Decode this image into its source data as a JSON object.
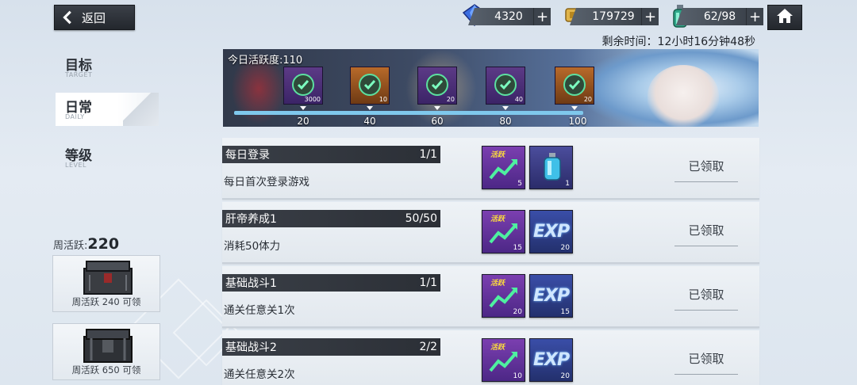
{
  "header": {
    "back_label": "返回",
    "crystals": "4320",
    "coins": "179729",
    "stamina": "62/98",
    "timer": "剩余时间：12小时16分钟48秒"
  },
  "sidebar": {
    "items": [
      {
        "zh": "目标",
        "en": "TARGET"
      },
      {
        "zh": "日常",
        "en": "DAILY"
      },
      {
        "zh": "等级",
        "en": "LEVEL"
      }
    ],
    "weekly_prefix": "周活跃:",
    "weekly_value": "220",
    "chests": [
      {
        "caption": "周活跃 240 可领"
      },
      {
        "caption": "周活跃 650 可领"
      }
    ]
  },
  "banner": {
    "title": "今日活跃度:110",
    "progress_fraction": 0.9,
    "milestones": [
      {
        "count": "3000",
        "label": "20",
        "style": "purple"
      },
      {
        "count": "10",
        "label": "40",
        "style": "gold"
      },
      {
        "count": "20",
        "label": "60",
        "style": "purple"
      },
      {
        "count": "40",
        "label": "80",
        "style": "purple"
      },
      {
        "count": "20",
        "label": "100",
        "style": "gold"
      }
    ]
  },
  "tasks": [
    {
      "name": "每日登录",
      "progress": "1/1",
      "desc": "每日首次登录游戏",
      "reward1_tag": "活跃",
      "reward1_count": "5",
      "reward2_type": "potion",
      "reward2_count": "1",
      "status": "已领取"
    },
    {
      "name": "肝帝养成1",
      "progress": "50/50",
      "desc": "消耗50体力",
      "reward1_tag": "活跃",
      "reward1_count": "15",
      "reward2_type": "exp",
      "reward2_label": "EXP",
      "reward2_count": "20",
      "status": "已领取"
    },
    {
      "name": "基础战斗1",
      "progress": "1/1",
      "desc": "通关任意关1次",
      "reward1_tag": "活跃",
      "reward1_count": "20",
      "reward2_type": "exp",
      "reward2_label": "EXP",
      "reward2_count": "15",
      "status": "已领取"
    },
    {
      "name": "基础战斗2",
      "progress": "2/2",
      "desc": "通关任意关2次",
      "reward1_tag": "活跃",
      "reward1_count": "10",
      "reward2_type": "exp",
      "reward2_label": "EXP",
      "reward2_count": "20",
      "status": "已领取"
    }
  ]
}
